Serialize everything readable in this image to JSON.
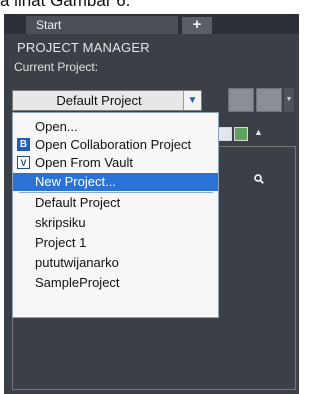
{
  "background_text": "a lihat Gambar 6.",
  "tabs": {
    "start_label": "Start",
    "add_label": "+"
  },
  "panel": {
    "title": "PROJECT MANAGER",
    "current_project_label": "Current Project:",
    "current_project_value": "Default Project"
  },
  "dropdown": {
    "items": [
      {
        "label": "Open...",
        "icon": ""
      },
      {
        "label": "Open Collaboration Project",
        "icon": "collaboration-icon",
        "icon_glyph": "B"
      },
      {
        "label": "Open From Vault",
        "icon": "vault-icon",
        "icon_glyph": "V"
      },
      {
        "label": "New Project...",
        "icon": "",
        "selected": true
      },
      {
        "label": "Default Project",
        "icon": ""
      },
      {
        "label": "skripsiku",
        "icon": ""
      },
      {
        "label": "Project 1",
        "icon": ""
      },
      {
        "label": "pututwijanarko",
        "icon": ""
      },
      {
        "label": "SampleProject",
        "icon": ""
      }
    ]
  },
  "colors": {
    "panel_bg": "#3b4046",
    "selection_bg": "#2a72d6",
    "dropdown_bg": "#f7f7f7",
    "collab_icon_bg": "#1f5db8"
  }
}
